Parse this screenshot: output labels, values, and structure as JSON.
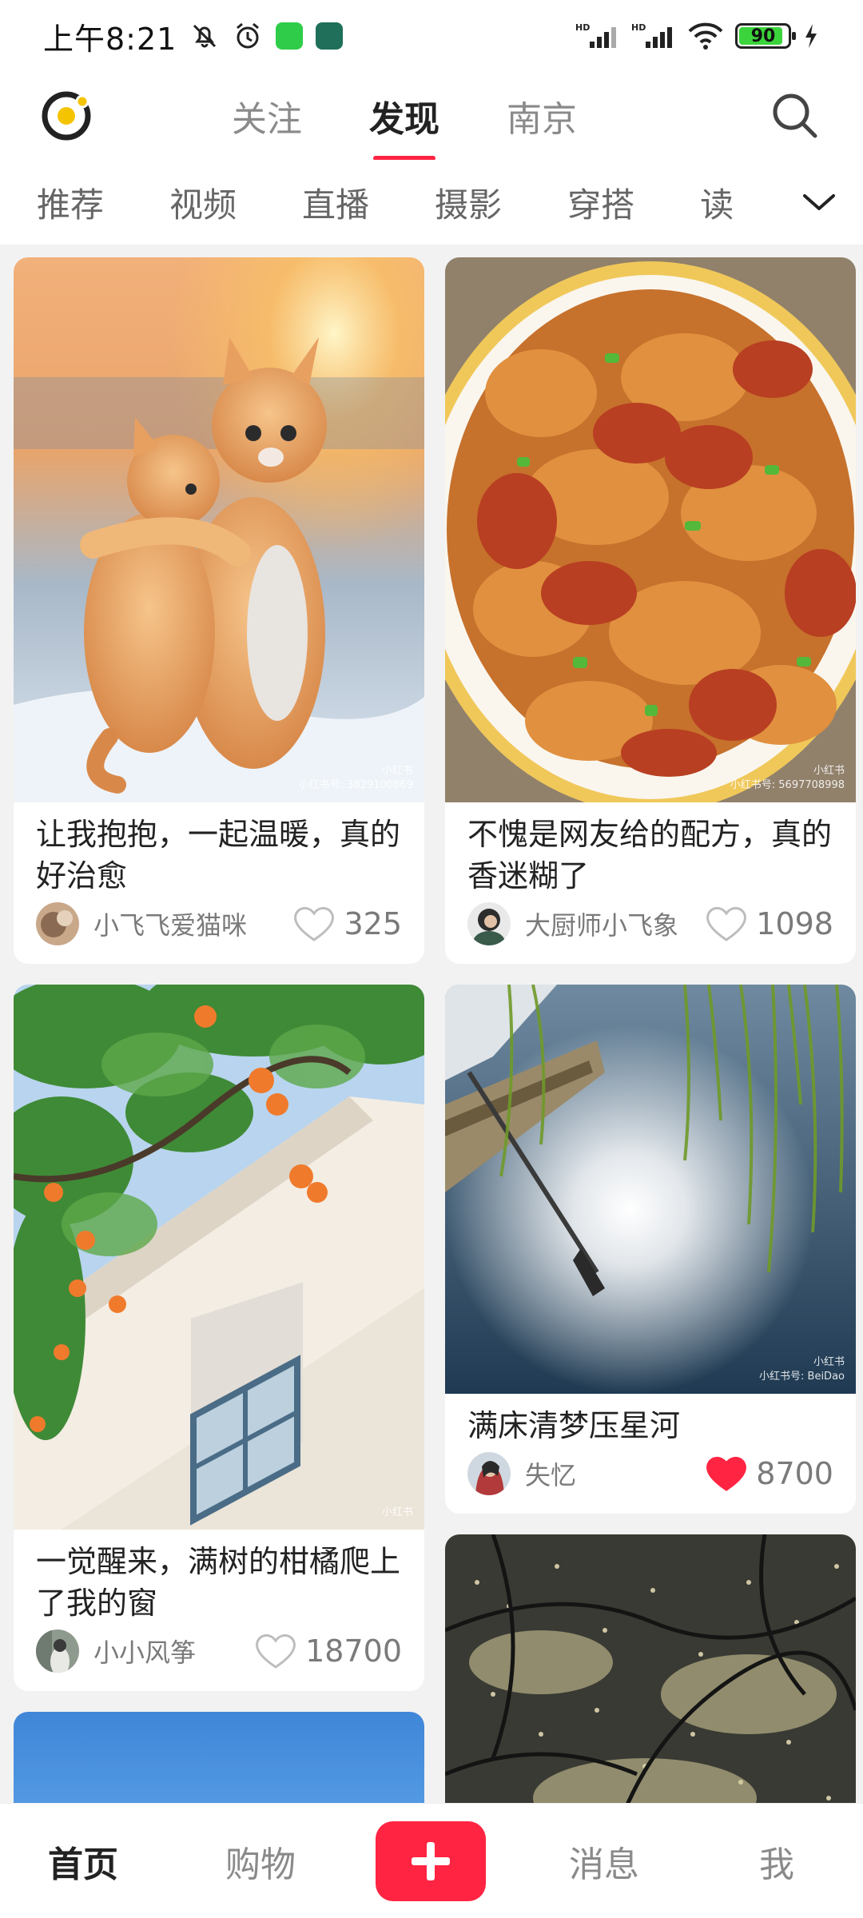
{
  "status_bar": {
    "time": "上午8:21",
    "battery": "90",
    "battery_level": 0.9
  },
  "top_nav": {
    "tabs": [
      "关注",
      "发现",
      "南京"
    ],
    "active_tab": "发现"
  },
  "categories": [
    "推荐",
    "视频",
    "直播",
    "摄影",
    "穿搭",
    "读"
  ],
  "feed": {
    "cards": [
      {
        "title": "让我抱抱，一起温暖，真的好治愈",
        "author": "小飞飞爱猫咪",
        "likes": "325",
        "liked": false,
        "watermark_brand": "小红书",
        "watermark_id": "小红书号: 3829100869"
      },
      {
        "title": "不愧是网友给的配方，真的香迷糊了",
        "author": "大厨师小飞象",
        "likes": "1098",
        "liked": false,
        "watermark_brand": "小红书",
        "watermark_id": "小红书号: 5697708998"
      },
      {
        "title": "一觉醒来，满树的柑橘爬上了我的窗",
        "author": "小小风筝",
        "likes": "18700",
        "liked": false,
        "watermark_brand": "小红书"
      },
      {
        "title": "满床清梦压星河",
        "author": "失忆",
        "likes": "8700",
        "liked": true,
        "watermark_brand": "小红书",
        "watermark_id": "小红书号: BeiDao"
      }
    ]
  },
  "bottom_nav": {
    "items": [
      "首页",
      "购物",
      "消息",
      "我"
    ],
    "active": "首页"
  },
  "colors": {
    "accent": "#ff2442",
    "text": "#222222",
    "muted": "#8a8a8a",
    "background": "#f2f2f2"
  },
  "icons": {
    "logo": "ring-logo-icon",
    "search": "search-icon",
    "more": "chevron-down-icon",
    "like": "heart-icon",
    "publish": "plus-icon"
  }
}
